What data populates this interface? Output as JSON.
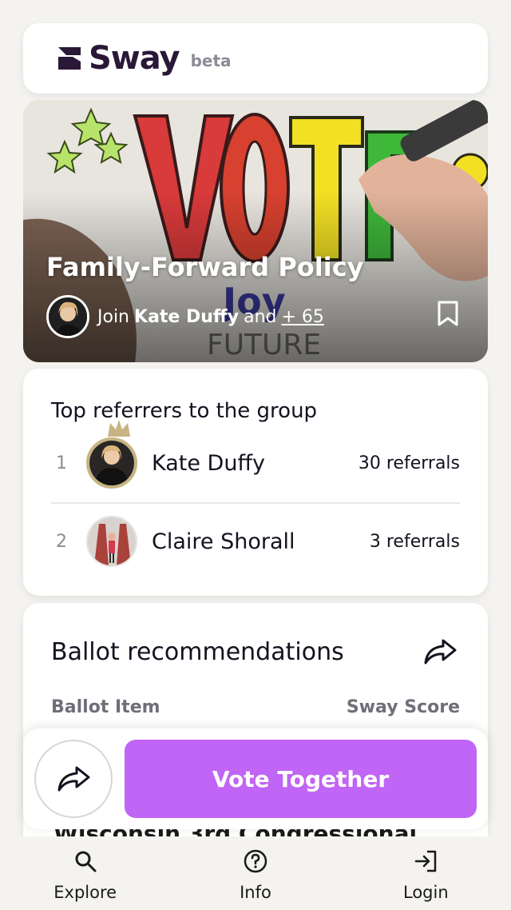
{
  "header": {
    "brand": "Sway",
    "tag": "beta"
  },
  "hero": {
    "title": "Family-Forward Policy",
    "join_prefix": "Join",
    "join_name": "Kate Duffy",
    "join_and": "and",
    "join_more": "+ 65"
  },
  "referrers": {
    "title": "Top referrers to the group",
    "rows": [
      {
        "rank": "1",
        "name": "Kate Duffy",
        "count": "30 referrals"
      },
      {
        "rank": "2",
        "name": "Claire Shorall",
        "count": "3 referrals"
      }
    ]
  },
  "ballot": {
    "title": "Ballot recommendations",
    "col_left": "Ballot Item",
    "col_right": "Sway Score",
    "peek_item": "Wisconsin 3rd Congressional"
  },
  "actions": {
    "vote_label": "Vote Together"
  },
  "nav": [
    {
      "label": "Explore",
      "icon": "search-icon"
    },
    {
      "label": "Info",
      "icon": "help-circle-icon"
    },
    {
      "label": "Login",
      "icon": "login-icon"
    }
  ],
  "colors": {
    "accent": "#c065f5",
    "brand": "#2a1838",
    "background": "#f4f3f0"
  }
}
